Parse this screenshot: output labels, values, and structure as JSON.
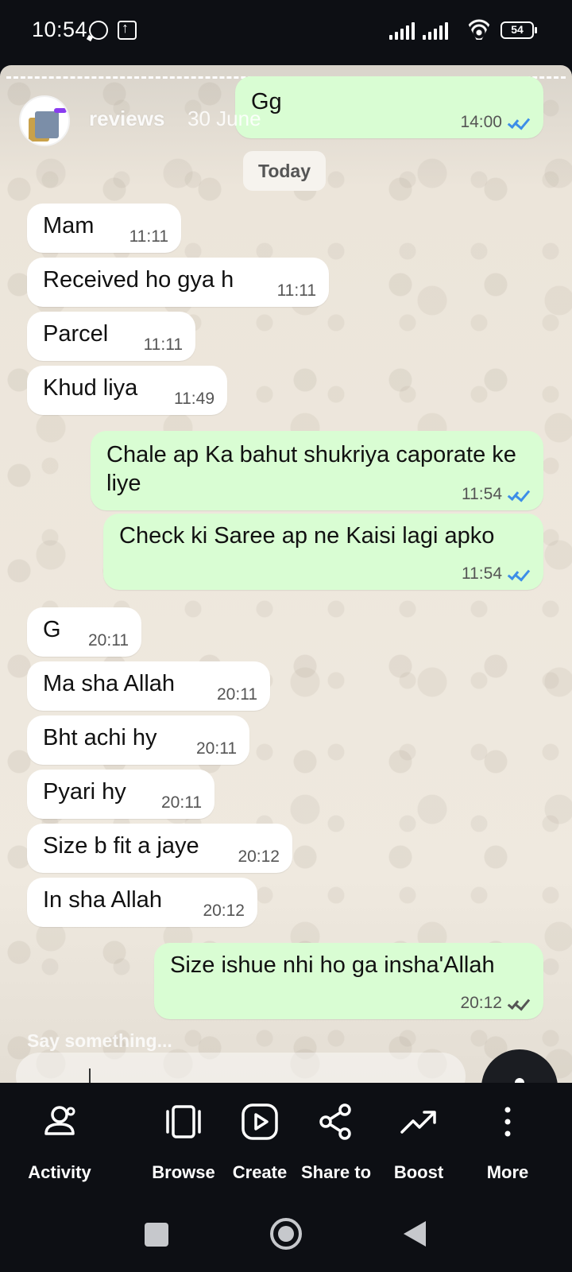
{
  "status_bar": {
    "time": "10:54",
    "battery": "54"
  },
  "story": {
    "username": "reviews",
    "date": "30 June",
    "date_chip": "Today",
    "input_placeholder": "Say something...",
    "top_message": {
      "text": "Gg",
      "time": "14:00"
    },
    "messages": [
      {
        "dir": "in",
        "text": "Mam",
        "time": "11:11"
      },
      {
        "dir": "in",
        "text": "Received ho gya h",
        "time": "11:11"
      },
      {
        "dir": "in",
        "text": "Parcel",
        "time": "11:11"
      },
      {
        "dir": "in",
        "text": "Khud liya",
        "time": "11:49"
      },
      {
        "dir": "out",
        "text": "Chale ap Ka bahut shukriya caporate ke liye",
        "time": "11:54",
        "read": true
      },
      {
        "dir": "out",
        "text": "Check ki Saree ap ne Kaisi lagi apko",
        "time": "11:54",
        "read": true
      },
      {
        "dir": "in",
        "text": "G",
        "time": "20:11"
      },
      {
        "dir": "in",
        "text": "Ma sha Allah",
        "time": "20:11"
      },
      {
        "dir": "in",
        "text": "Bht achi hy",
        "time": "20:11"
      },
      {
        "dir": "in",
        "text": "Pyari hy",
        "time": "20:11"
      },
      {
        "dir": "in",
        "text": "Size b fit a jaye",
        "time": "20:12"
      },
      {
        "dir": "in",
        "text": "In sha Allah",
        "time": "20:12"
      },
      {
        "dir": "out",
        "text": "Size ishue nhi ho ga insha'Allah",
        "time": "20:12",
        "read": false
      }
    ]
  },
  "actions": [
    {
      "label": "Activity",
      "icon": "activity-icon"
    },
    {
      "label": "Browse",
      "icon": "browse-icon"
    },
    {
      "label": "Create",
      "icon": "create-icon"
    },
    {
      "label": "Share to",
      "icon": "share-icon"
    },
    {
      "label": "Boost",
      "icon": "boost-icon"
    },
    {
      "label": "More",
      "icon": "more-icon"
    }
  ],
  "colors": {
    "outgoing_bubble": "#d9fdd3",
    "incoming_bubble": "#ffffff",
    "read_tick": "#3d8ee8",
    "dark_bg": "#0d0f14"
  }
}
